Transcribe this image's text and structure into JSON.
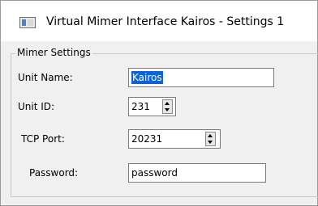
{
  "window": {
    "title": "Virtual Mimer Interface Kairos - Settings 1",
    "icon": "app-window-icon"
  },
  "group": {
    "label": "Mimer Settings"
  },
  "fields": {
    "unit_name": {
      "label": "Unit Name:",
      "value": "Kairos"
    },
    "unit_id": {
      "label": "Unit ID:",
      "value": "231"
    },
    "tcp_port": {
      "label": "TCP Port:",
      "value": "20231"
    },
    "password": {
      "label": "Password:",
      "value": "password"
    }
  },
  "colors": {
    "selection": "#0a64d8",
    "window_bg": "#f0f0f0",
    "field_border": "#7a7a7a"
  }
}
